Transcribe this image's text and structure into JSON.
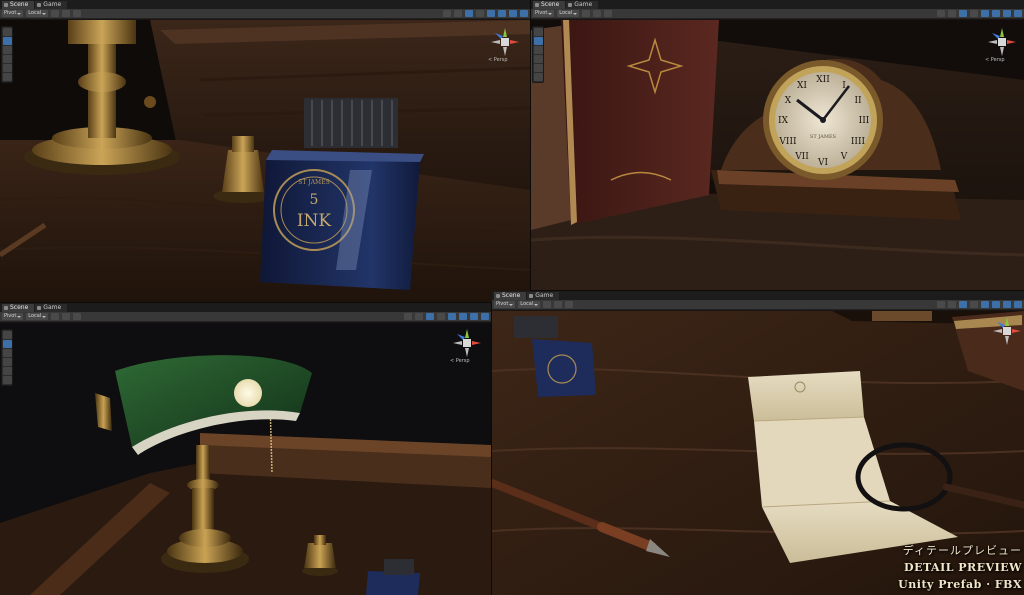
{
  "editor": {
    "tabs": {
      "scene": "Scene",
      "game": "Game"
    },
    "toolbar": {
      "pivot": "Pivot",
      "local": "Local"
    },
    "camera_mode": "< Persp"
  },
  "caption": {
    "line1": "ディテールプレビュー",
    "line2": "DETAIL PREVIEW",
    "line3": "Unity Prefab · FBX"
  },
  "props": {
    "ink_label_top": "ST JAMES",
    "ink_label_main": "INK",
    "ink_label_num": "5",
    "clock_brand": "ST JAMES",
    "clock_numerals": [
      "XII",
      "I",
      "II",
      "III",
      "IIII",
      "V",
      "VI",
      "VII",
      "VIII",
      "IX",
      "X",
      "XI"
    ]
  },
  "colors": {
    "wood_dark": "#2a1a10",
    "wood_mid": "#4a2e1b",
    "brass": "#b08a3e",
    "ink_blue": "#1d2c5a",
    "lamp_green": "#1e4a24",
    "paper": "#d9cdb0",
    "unity_blue": "#3d6fa8"
  }
}
